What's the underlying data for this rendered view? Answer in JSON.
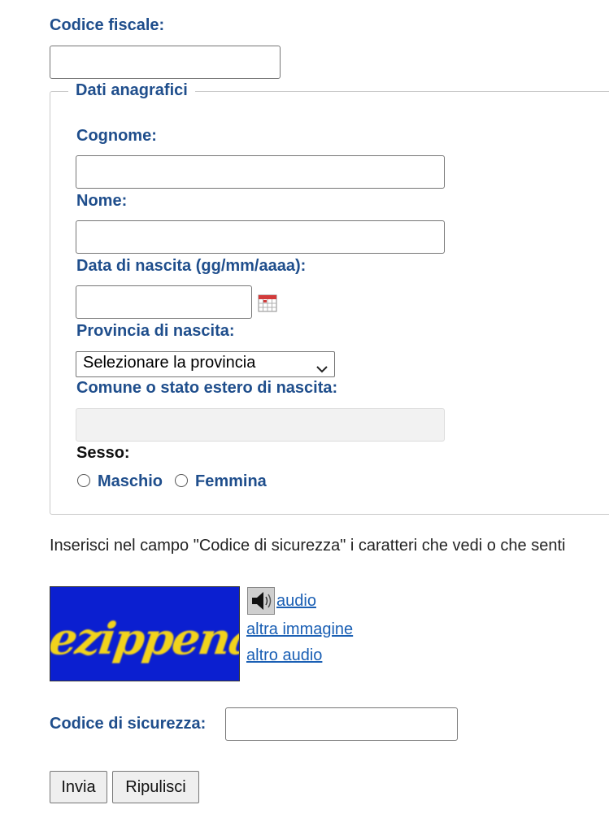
{
  "codice_fiscale": {
    "label": "Codice fiscale:",
    "value": ""
  },
  "dati_anagrafici": {
    "legend": "Dati anagrafici",
    "cognome": {
      "label": "Cognome:",
      "value": ""
    },
    "nome": {
      "label": "Nome:",
      "value": ""
    },
    "data_nascita": {
      "label": "Data di nascita (gg/mm/aaaa):",
      "value": ""
    },
    "provincia": {
      "label": "Provincia di nascita:",
      "selected": "Selezionare la provincia"
    },
    "comune": {
      "label": "Comune o stato estero di nascita:",
      "value": ""
    },
    "sesso": {
      "label": "Sesso:",
      "options": [
        "Maschio",
        "Femmina"
      ]
    }
  },
  "instructions": "Inserisci nel campo \"Codice di sicurezza\" i caratteri che vedi o che senti",
  "captcha": {
    "image_text": "ezippena",
    "audio_link": "audio",
    "new_image_link": "altra immagine",
    "new_audio_link": "altro audio"
  },
  "security_code": {
    "label": "Codice di sicurezza:",
    "value": ""
  },
  "buttons": {
    "submit": "Invia",
    "reset": "Ripulisci"
  },
  "colors": {
    "label": "#1f4e8c",
    "link": "#1a5fb4",
    "captcha_bg": "#0b1fd0",
    "captcha_text": "#f2d31a"
  }
}
